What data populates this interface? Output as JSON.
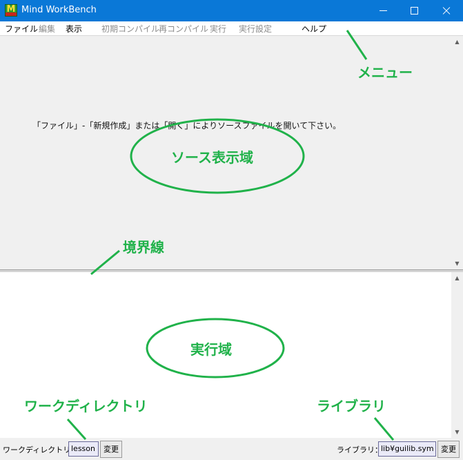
{
  "window": {
    "title": "Mind WorkBench"
  },
  "menu": {
    "items": [
      {
        "label": "ファイル",
        "enabled": true
      },
      {
        "label": "編集",
        "enabled": false
      },
      {
        "label": "表示",
        "enabled": true
      },
      {
        "label": "初期コンパイル",
        "enabled": false
      },
      {
        "label": "再コンパイル",
        "enabled": false
      },
      {
        "label": "実行",
        "enabled": false
      },
      {
        "label": "実行設定",
        "enabled": false
      },
      {
        "label": "ヘルプ",
        "enabled": true
      }
    ]
  },
  "source_pane": {
    "hint": "「ファイル」-「新規作成」または「開く」によりソースファイルを開いて下さい。"
  },
  "statusbar": {
    "workdir_label": "ワークディレクトリ：",
    "workdir_value": "lesson",
    "workdir_button": "変更",
    "library_label": "ライブラリ：",
    "library_value": "lib¥guilib.sym",
    "library_button": "変更"
  },
  "annotations": {
    "menu": "メニュー",
    "source_area": "ソース表示域",
    "splitter": "境界線",
    "exec_area": "実行域",
    "workdir": "ワークディレクトリ",
    "library": "ライブラリ"
  },
  "colors": {
    "titlebar": "#0a78d7",
    "annotation": "#20b24a",
    "source_background": "#f0f0f0"
  }
}
